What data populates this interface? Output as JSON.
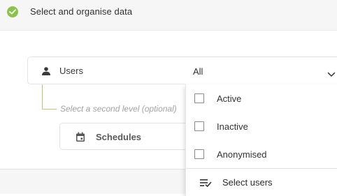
{
  "header": {
    "title": "Select and organise data",
    "icon": "check-circle-icon",
    "accent_color": "#8bc34a"
  },
  "first_level": {
    "label": "Users",
    "icon": "user-icon",
    "selected_value": "All"
  },
  "second_level": {
    "placeholder": "Select a second level (optional)",
    "item": {
      "label": "Schedules",
      "icon": "calendar-icon"
    }
  },
  "dropdown": {
    "options": [
      {
        "label": "Active",
        "checked": false
      },
      {
        "label": "Inactive",
        "checked": false
      },
      {
        "label": "Anonymised",
        "checked": false
      }
    ],
    "action": {
      "label": "Select users",
      "icon": "select-list-icon"
    }
  }
}
